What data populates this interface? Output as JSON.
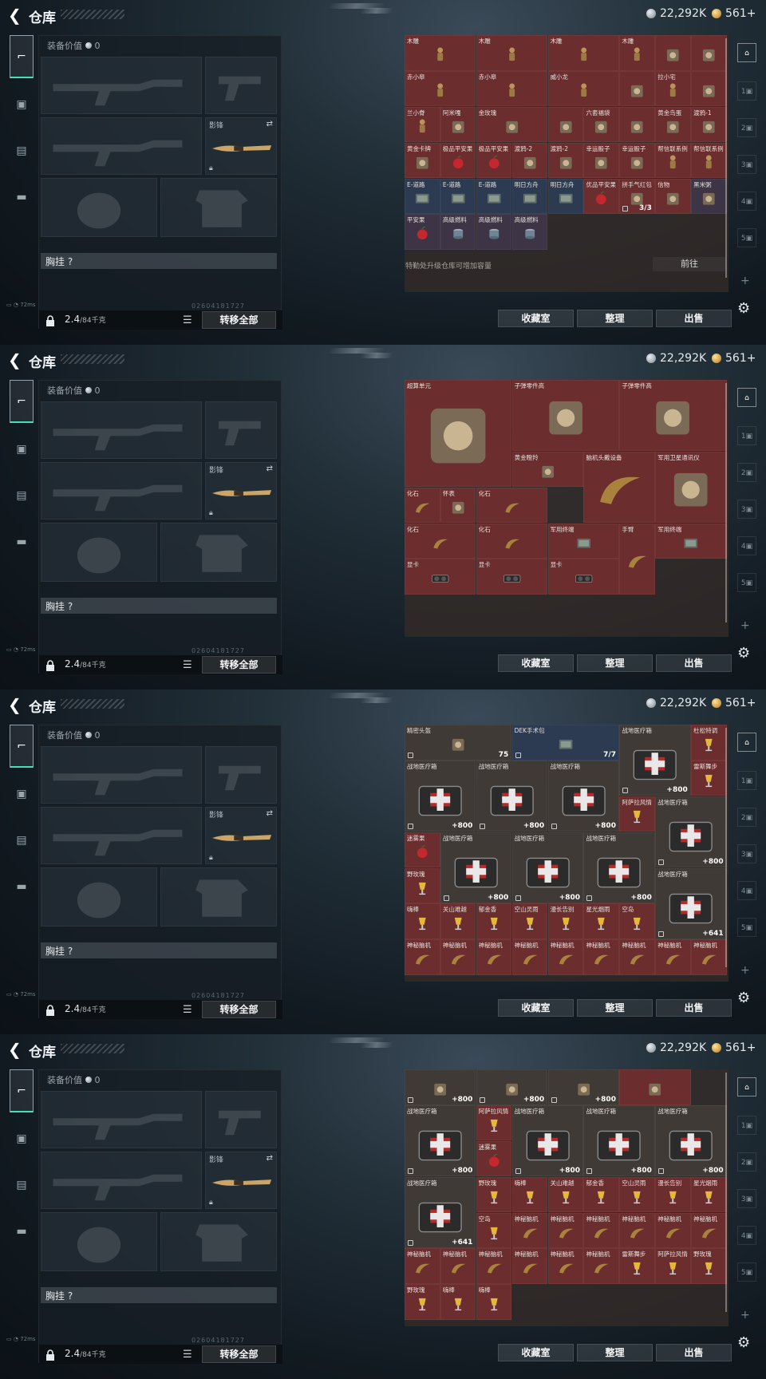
{
  "header": {
    "title": "仓库",
    "silver": "22,292K",
    "gold": "561+"
  },
  "gear": {
    "equip_value_label": "装备价值",
    "equip_value": "0",
    "slot_knife_label": "影锋",
    "chest_label": "胸挂",
    "chest_hint": "?",
    "weight": "2.4",
    "weight_max": "/84千克",
    "transfer_all": "转移全部",
    "build_id": "02604181727",
    "status": "72ms"
  },
  "buttons": {
    "collection": "收藏室",
    "organize": "整理",
    "sell": "出售",
    "goto": "前往"
  },
  "tip": "特勤处升级仓库可增加容量",
  "colors": {
    "red": "#6b2d2d",
    "gold": "#5e4f2c",
    "purple": "#3d3546",
    "blue": "#2c3a52",
    "gray": "#3f3a36",
    "bg": "#4b3f38",
    "empty": "#3a322e"
  },
  "panels": [
    {
      "cells": [
        {
          "n": "木雕",
          "c": "red"
        },
        {
          "n": "木雕",
          "c": "red"
        },
        {
          "n": "木雕",
          "c": "red"
        },
        {
          "n": "木雕",
          "c": "red"
        },
        {
          "n": "",
          "c": "red"
        },
        {
          "n": "",
          "c": "red"
        },
        {
          "n": "赤小皋",
          "c": "red"
        },
        {
          "n": "赤小皋",
          "c": "red"
        },
        {
          "n": "威小龙",
          "c": "red"
        },
        {
          "n": "",
          "c": "red"
        },
        {
          "n": "拉小宅",
          "c": "red"
        },
        {
          "n": "",
          "c": "red"
        },
        {
          "n": "兰小脊",
          "c": "red"
        },
        {
          "n": "阿米嘎",
          "c": "red"
        },
        {
          "n": "金玫瑰",
          "c": "red"
        },
        {
          "n": "",
          "c": "red"
        },
        {
          "n": "六套福袋",
          "c": "red"
        },
        {
          "n": "",
          "c": "red"
        },
        {
          "n": "黄金鸟蛋",
          "c": "red"
        },
        {
          "n": "渡鸦-1",
          "c": "red"
        },
        {
          "n": "黄金卡牌",
          "c": "red"
        },
        {
          "n": "极品平安果",
          "c": "red"
        },
        {
          "n": "极品平安果",
          "c": "red"
        },
        {
          "n": "渡鸦-2",
          "c": "red"
        },
        {
          "n": "渡鸦-2",
          "c": "red"
        },
        {
          "n": "幸运骰子",
          "c": "red"
        },
        {
          "n": "幸运骰子",
          "c": "red"
        },
        {
          "n": "帮信联系例",
          "c": "red"
        },
        {
          "n": "帮信联系例",
          "c": "red"
        },
        {
          "n": "E-道路",
          "c": "blue"
        },
        {
          "n": "E-道路",
          "c": "blue"
        },
        {
          "n": "E-道路",
          "c": "blue"
        },
        {
          "n": "明日方舟",
          "c": "blue"
        },
        {
          "n": "明日方舟",
          "c": "blue"
        },
        {
          "n": "优品平安果",
          "c": "red"
        },
        {
          "n": "拼手气红包",
          "c": "red",
          "q": "3/3"
        },
        {
          "n": "信物",
          "c": "red"
        },
        {
          "n": "黑米粥",
          "c": "purple"
        },
        {
          "n": "平安果",
          "c": "purple"
        },
        {
          "n": "高级燃料",
          "c": "purple"
        },
        {
          "n": "高级燃料",
          "c": "purple"
        },
        {
          "n": "高级燃料",
          "c": "purple"
        }
      ]
    },
    {
      "cells": [
        {
          "n": "超算单元",
          "c": "red"
        },
        {
          "n": "子弹零件高",
          "c": "red"
        },
        {
          "n": "子弹零件高",
          "c": "red"
        },
        {
          "n": "黄金瞪羚",
          "c": "red"
        },
        {
          "n": "脑机头戴设备",
          "c": "red"
        },
        {
          "n": "军用卫星通讯仪",
          "c": "red"
        },
        {
          "n": "化石",
          "c": "red"
        },
        {
          "n": "怀表",
          "c": "red"
        },
        {
          "n": "化石",
          "c": "red"
        },
        {
          "n": "化石",
          "c": "red"
        },
        {
          "n": "化石",
          "c": "red"
        },
        {
          "n": "军用终端",
          "c": "red"
        },
        {
          "n": "手臂",
          "c": "red"
        },
        {
          "n": "军用终端",
          "c": "red"
        },
        {
          "n": "显卡",
          "c": "red"
        },
        {
          "n": "显卡",
          "c": "red"
        },
        {
          "n": "显卡",
          "c": "red"
        }
      ]
    },
    {
      "cells": [
        {
          "n": "精密头盔",
          "c": "gray",
          "q": "75"
        },
        {
          "n": "DEK手术包",
          "c": "blue",
          "q": "7/7"
        },
        {
          "n": "战地医疗箱",
          "c": "gray",
          "q": "800"
        },
        {
          "n": "杜松特调",
          "c": "red"
        },
        {
          "n": "战地医疗箱",
          "c": "gray",
          "q": "800"
        },
        {
          "n": "战地医疗箱",
          "c": "gray",
          "q": "800"
        },
        {
          "n": "战地医疗箱",
          "c": "gray",
          "q": "800"
        },
        {
          "n": "雷斯舞步",
          "c": "red"
        },
        {
          "n": "阿萨拉风情",
          "c": "red"
        },
        {
          "n": "战地医疗箱",
          "c": "gray",
          "q": "800"
        },
        {
          "n": "迷雾果",
          "c": "red"
        },
        {
          "n": "战地医疗箱",
          "c": "gray",
          "q": "800"
        },
        {
          "n": "战地医疗箱",
          "c": "gray",
          "q": "800"
        },
        {
          "n": "战地医疗箱",
          "c": "gray",
          "q": "800"
        },
        {
          "n": "野玫瑰",
          "c": "red"
        },
        {
          "n": "战地医疗箱",
          "c": "gray",
          "q": "641"
        },
        {
          "n": "嗨棒",
          "c": "red"
        },
        {
          "n": "关山难越",
          "c": "red"
        },
        {
          "n": "郁金香",
          "c": "red"
        },
        {
          "n": "空山灵雨",
          "c": "red"
        },
        {
          "n": "漫长告别",
          "c": "red"
        },
        {
          "n": "星光烟雨",
          "c": "red"
        },
        {
          "n": "空岛",
          "c": "red"
        },
        {
          "n": "神秘脑机",
          "c": "red"
        },
        {
          "n": "神秘脑机",
          "c": "red"
        },
        {
          "n": "神秘脑机",
          "c": "red"
        },
        {
          "n": "神秘脑机",
          "c": "red"
        },
        {
          "n": "神秘脑机",
          "c": "red"
        },
        {
          "n": "神秘脑机",
          "c": "red"
        },
        {
          "n": "神秘脑机",
          "c": "red"
        },
        {
          "n": "神秘脑机",
          "c": "red"
        },
        {
          "n": "神秘脑机",
          "c": "red"
        }
      ]
    },
    {
      "cells": [
        {
          "n": "",
          "c": "gray",
          "q": "800"
        },
        {
          "n": "",
          "c": "gray",
          "q": "800"
        },
        {
          "n": "",
          "c": "gray",
          "q": "800"
        },
        {
          "n": "",
          "c": "red"
        },
        {
          "n": "战地医疗箱",
          "c": "gray",
          "q": "800"
        },
        {
          "n": "阿萨拉风情",
          "c": "red"
        },
        {
          "n": "战地医疗箱",
          "c": "gray",
          "q": "800"
        },
        {
          "n": "战地医疗箱",
          "c": "gray",
          "q": "800"
        },
        {
          "n": "战地医疗箱",
          "c": "gray",
          "q": "800"
        },
        {
          "n": "迷雾果",
          "c": "red"
        },
        {
          "n": "战地医疗箱",
          "c": "gray",
          "q": "641"
        },
        {
          "n": "野玫瑰",
          "c": "red"
        },
        {
          "n": "嗨棒",
          "c": "red"
        },
        {
          "n": "关山难越",
          "c": "red"
        },
        {
          "n": "郁金香",
          "c": "red"
        },
        {
          "n": "空山灵雨",
          "c": "red"
        },
        {
          "n": "漫长告别",
          "c": "red"
        },
        {
          "n": "星光烟雨",
          "c": "red"
        },
        {
          "n": "空岛",
          "c": "red"
        },
        {
          "n": "神秘脑机",
          "c": "red"
        },
        {
          "n": "神秘脑机",
          "c": "red"
        },
        {
          "n": "神秘脑机",
          "c": "red"
        },
        {
          "n": "神秘脑机",
          "c": "red"
        },
        {
          "n": "神秘脑机",
          "c": "red"
        },
        {
          "n": "神秘脑机",
          "c": "red"
        },
        {
          "n": "神秘脑机",
          "c": "red"
        },
        {
          "n": "神秘脑机",
          "c": "red"
        },
        {
          "n": "神秘脑机",
          "c": "red"
        },
        {
          "n": "神秘脑机",
          "c": "red"
        },
        {
          "n": "神秘脑机",
          "c": "red"
        },
        {
          "n": "神秘脑机",
          "c": "red"
        },
        {
          "n": "雷斯舞步",
          "c": "red"
        },
        {
          "n": "阿萨拉风情",
          "c": "red"
        },
        {
          "n": "野玫瑰",
          "c": "red"
        },
        {
          "n": "野玫瑰",
          "c": "red"
        },
        {
          "n": "嗨棒",
          "c": "red"
        },
        {
          "n": "嗨棒",
          "c": "red"
        }
      ]
    }
  ]
}
